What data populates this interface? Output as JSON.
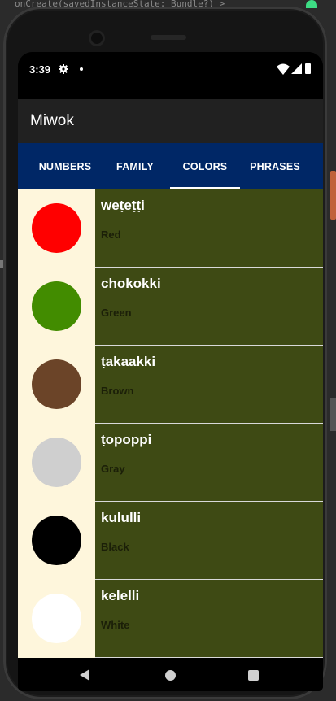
{
  "ide": {
    "snippet": "onCreate(savedInstanceState: Bundle?) >"
  },
  "status_bar": {
    "time": "3:39"
  },
  "app": {
    "title": "Miwok"
  },
  "tabs": [
    {
      "label": "NUMBERS",
      "selected": false
    },
    {
      "label": "FAMILY",
      "selected": false
    },
    {
      "label": "COLORS",
      "selected": true
    },
    {
      "label": "PHRASES",
      "selected": false
    }
  ],
  "colors": [
    {
      "miwok": "weṭeṭṭi",
      "english": "Red",
      "swatch": "#ff0000"
    },
    {
      "miwok": "chokokki",
      "english": "Green",
      "swatch": "#428c00"
    },
    {
      "miwok": "ṭakaakki",
      "english": "Brown",
      "swatch": "#6b4428"
    },
    {
      "miwok": "ṭopoppi",
      "english": "Gray",
      "swatch": "#cfcfcf"
    },
    {
      "miwok": "kululli",
      "english": "Black",
      "swatch": "#000000"
    },
    {
      "miwok": "kelelli",
      "english": "White",
      "swatch": "#ffffff"
    }
  ],
  "theme": {
    "app_bar": "#212121",
    "tab_bar": "#002766",
    "row_text_bg": "#3e4a14",
    "row_swatch_bg": "#fef6dc"
  },
  "icons": {
    "status": [
      "gear-icon",
      "notification-dot-icon",
      "wifi-icon",
      "signal-icon",
      "battery-icon"
    ],
    "nav": [
      "back-icon",
      "home-icon",
      "recents-icon"
    ]
  }
}
